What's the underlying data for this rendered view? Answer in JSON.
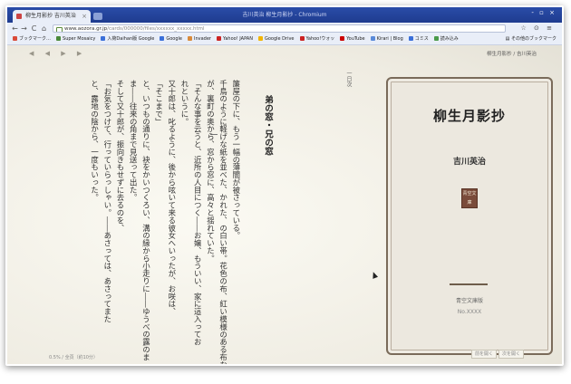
{
  "window": {
    "title": "吉川英治 柳生月影抄 - Chromium",
    "tab_title": "柳生月影抄 吉川英治",
    "controls": "- ▫ ×"
  },
  "toolbar": {
    "back": "←",
    "forward": "→",
    "reload": "C",
    "home": "⌂",
    "url_host": "www.aozora.gr.jp",
    "url_path": "/cards/000000/files/xxxxxx_xxxxx.html",
    "url_icons": "☆ ⊙ ≡"
  },
  "bookmarks": {
    "items": [
      {
        "label": "ブックマーク…",
        "color": "#d94a3a"
      },
      {
        "label": "Super Mosaicy",
        "color": "#4a8a3a"
      },
      {
        "label": "入荷Daihan版 Google",
        "color": "#3a6fd9"
      },
      {
        "label": "Google",
        "color": "#3a6fd9"
      },
      {
        "label": "Invader",
        "color": "#d98a3a"
      },
      {
        "label": "Yahoo! JAPAN",
        "color": "#cc2222"
      },
      {
        "label": "Google Drive",
        "color": "#f2b400"
      },
      {
        "label": "Yahoo!ウォッ",
        "color": "#cc2222"
      },
      {
        "label": "YouTube",
        "color": "#cc0000"
      },
      {
        "label": "Kirari | Blog",
        "color": "#5a8ad9"
      },
      {
        "label": "コミス",
        "color": "#3a6fd9"
      },
      {
        "label": "読み込み",
        "color": "#4a9a4a"
      }
    ],
    "other": "その他のブックマーク"
  },
  "reader": {
    "nav_arrows": "◀ ◀ ▶ ▶",
    "breadcrumb": "柳生月影抄 / 吉川英治",
    "date_mark": "一日次",
    "chapter_title": "弟の窓・兄の窓",
    "lines": [
      "簾屋の下に、もう一幅の薄闇が被さっている。",
      "千鳥のように軽げな紙を並べた、かれた、の白い帯。花色の布、紅い模様のある布など",
      "が、裏町の奥から、窓から窓に、高々と揺れていた。",
      "「そんな事を云うと、近所の人目につく――お嬢、もういい、家に這入ってお",
      "れというに。",
      "又十郎は、叱るように、後から呟いて来る彼女へいったが、お咲は、",
      "「そこまで」",
      "と、いつもの通りに、袂をかいつくろい、溝の縁から小走りに――ゆうべの露のま",
      "ま――往来の角まで見送って出た。",
      "そして又十郎が、振向きもせずに去るのを、",
      "「お気をつけて、行っていらっしゃい。――あさっては、あさってまた",
      "と、露地の陰から、一度もいった。"
    ],
    "status": "0.5% / 全頁（約10分）",
    "footer_buttons": [
      "前を開く",
      "次を開く"
    ]
  },
  "cover": {
    "title": "柳生月影抄",
    "author": "吉川英治",
    "seal": "青空文庫",
    "publisher": "青空文庫版",
    "number": "No.XXXX"
  }
}
